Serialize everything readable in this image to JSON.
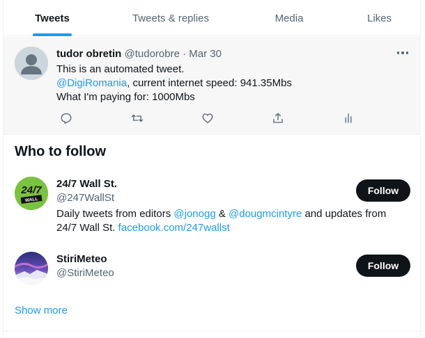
{
  "tabs": [
    {
      "label": "Tweets",
      "active": true
    },
    {
      "label": "Tweets & replies",
      "active": false
    },
    {
      "label": "Media",
      "active": false
    },
    {
      "label": "Likes",
      "active": false
    }
  ],
  "tweet": {
    "author_name": "tudor obretin",
    "author_handle": "@tudorobre",
    "separator": "·",
    "date": "Mar 30",
    "line1": "This is an automated tweet.",
    "mention": "@DigiRomania",
    "line2_rest": ", current internet speed: 941.35Mbs",
    "line3": "What I'm paying for: 1000Mbs",
    "actions": [
      "reply-icon",
      "retweet-icon",
      "like-icon",
      "share-icon",
      "analytics-icon"
    ]
  },
  "who_to_follow": {
    "title": "Who to follow",
    "users": [
      {
        "name": "24/7 Wall St.",
        "handle": "@247WallSt",
        "bio_1": "Daily tweets from editors ",
        "bio_mention_1": "@jonogg",
        "bio_2": " & ",
        "bio_mention_2": "@dougmcintyre",
        "bio_3": " and updates from",
        "bio_4": "24/7 Wall St. ",
        "bio_link": "facebook.com/247wallst",
        "logo_text_top": "24/7",
        "logo_text_bottom": "WALL",
        "button": "Follow"
      },
      {
        "name": "StiriMeteo",
        "handle": "@StiriMeteo",
        "button": "Follow"
      }
    ],
    "show_more": "Show more"
  },
  "colors": {
    "accent": "#1d9bf0",
    "text": "#0f1419",
    "muted": "#536471",
    "tweet_bg": "#f7f7f7",
    "button_bg": "#0f1419",
    "wallst_green": "#7cc242"
  }
}
